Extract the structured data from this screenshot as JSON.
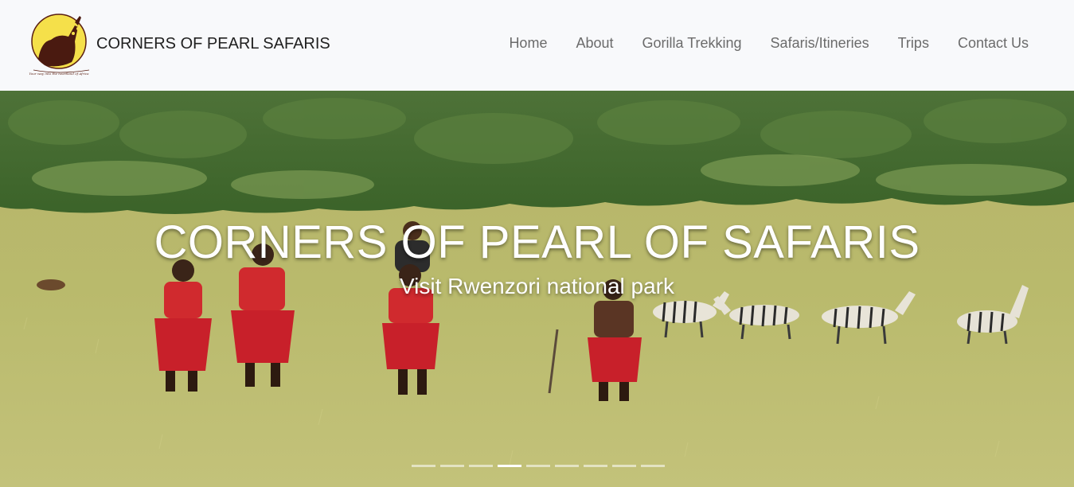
{
  "brand": {
    "name": "CORNERS OF PEARL SAFARIS",
    "logo_text": "CORNERS OF PEARL SAFARIS",
    "logo_tagline": "Your way into the heartland of Africa"
  },
  "nav": {
    "items": [
      {
        "label": "Home"
      },
      {
        "label": "About"
      },
      {
        "label": "Gorilla Trekking"
      },
      {
        "label": "Safaris/Itineries"
      },
      {
        "label": "Trips"
      },
      {
        "label": "Contact Us"
      }
    ]
  },
  "hero": {
    "title": "CORNERS OF PEARL OF SAFARIS",
    "subtitle": "Visit Rwenzori national park",
    "slide_count": 9,
    "active_slide": 4
  },
  "colors": {
    "header_bg": "#f8f9fb",
    "nav_text": "#6b6b6b",
    "brand_text": "#212121",
    "grass": "#b9bb6a",
    "forest": "#3f6a2c",
    "robe_red": "#c8202a"
  }
}
